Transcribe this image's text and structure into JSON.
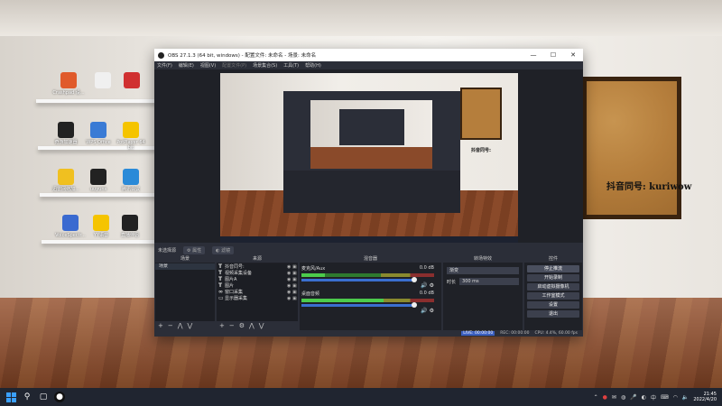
{
  "desktop": {
    "icons": [
      {
        "label": "Crashpad 设...",
        "color": "#e05a2b"
      },
      {
        "label": "",
        "color": "#f0f0f0"
      },
      {
        "label": "",
        "color": "#d03030"
      },
      {
        "label": "奇游加速器",
        "color": "#222222"
      },
      {
        "label": "WPS Office",
        "color": "#3a7bd5"
      },
      {
        "label": "PotPlayer 64 bit",
        "color": "#f5c400"
      },
      {
        "label": "迅雷网络加...",
        "color": "#f0c020"
      },
      {
        "label": "uuyuns",
        "color": "#222222"
      },
      {
        "label": "腾讯会议",
        "color": "#2a8ad8"
      },
      {
        "label": "VoiceSpectr...",
        "color": "#3a6ad0"
      },
      {
        "label": "YY语音",
        "color": "#f5c400"
      },
      {
        "label": "直播伴侣",
        "color": "#222222"
      }
    ],
    "overlay_text_left": "抖音同号:",
    "overlay_text_right": "抖音同号: kuriwow"
  },
  "window": {
    "title": "OBS 27.1.3 (64 bit, windows) - 配置文件: 未命名 - 场景: 未命名",
    "controls": {
      "minimize": "—",
      "maximize": "☐",
      "close": "✕"
    }
  },
  "menu": [
    "文件(F)",
    "编辑(E)",
    "视图(V)",
    "配置文件(P)",
    "场景集合(S)",
    "工具(T)",
    "帮助(H)"
  ],
  "dockbar": {
    "label": "未选择源",
    "properties": "属性",
    "filters": "滤镜"
  },
  "scenes": {
    "title": "场景",
    "items": [
      "场景"
    ]
  },
  "sources": {
    "title": "来源",
    "items": [
      {
        "icon": "T",
        "name": "抖音同号:"
      },
      {
        "icon": "T",
        "name": "视频采集设备"
      },
      {
        "icon": "T",
        "name": "图片A"
      },
      {
        "icon": "T",
        "name": "图片"
      },
      {
        "icon": "∞",
        "name": "窗口采集"
      },
      {
        "icon": "▭",
        "name": "显示器采集"
      }
    ]
  },
  "mixer": {
    "title": "混音器",
    "channels": [
      {
        "name": "麦克风/Aux",
        "db": "0.0 dB",
        "level": 0.18
      },
      {
        "name": "桌面音频",
        "db": "0.0 dB",
        "level": 0.62
      }
    ]
  },
  "transitions": {
    "title": "转场特效",
    "selected": "渐变",
    "duration_label": "时长",
    "duration_value": "300 ms"
  },
  "controls": {
    "title": "控件",
    "buttons": [
      "停止推流",
      "开始录制",
      "启动虚拟摄像机",
      "工作室模式",
      "设置",
      "退出"
    ]
  },
  "status": {
    "live": "LIVE: 00:00:00",
    "rec": "REC: 00:00:00",
    "cpu": "CPU: 4.4%, 60.00 fps"
  },
  "taskbar": {
    "time": "21:45",
    "date": "2022/4/20",
    "lang": "中"
  }
}
